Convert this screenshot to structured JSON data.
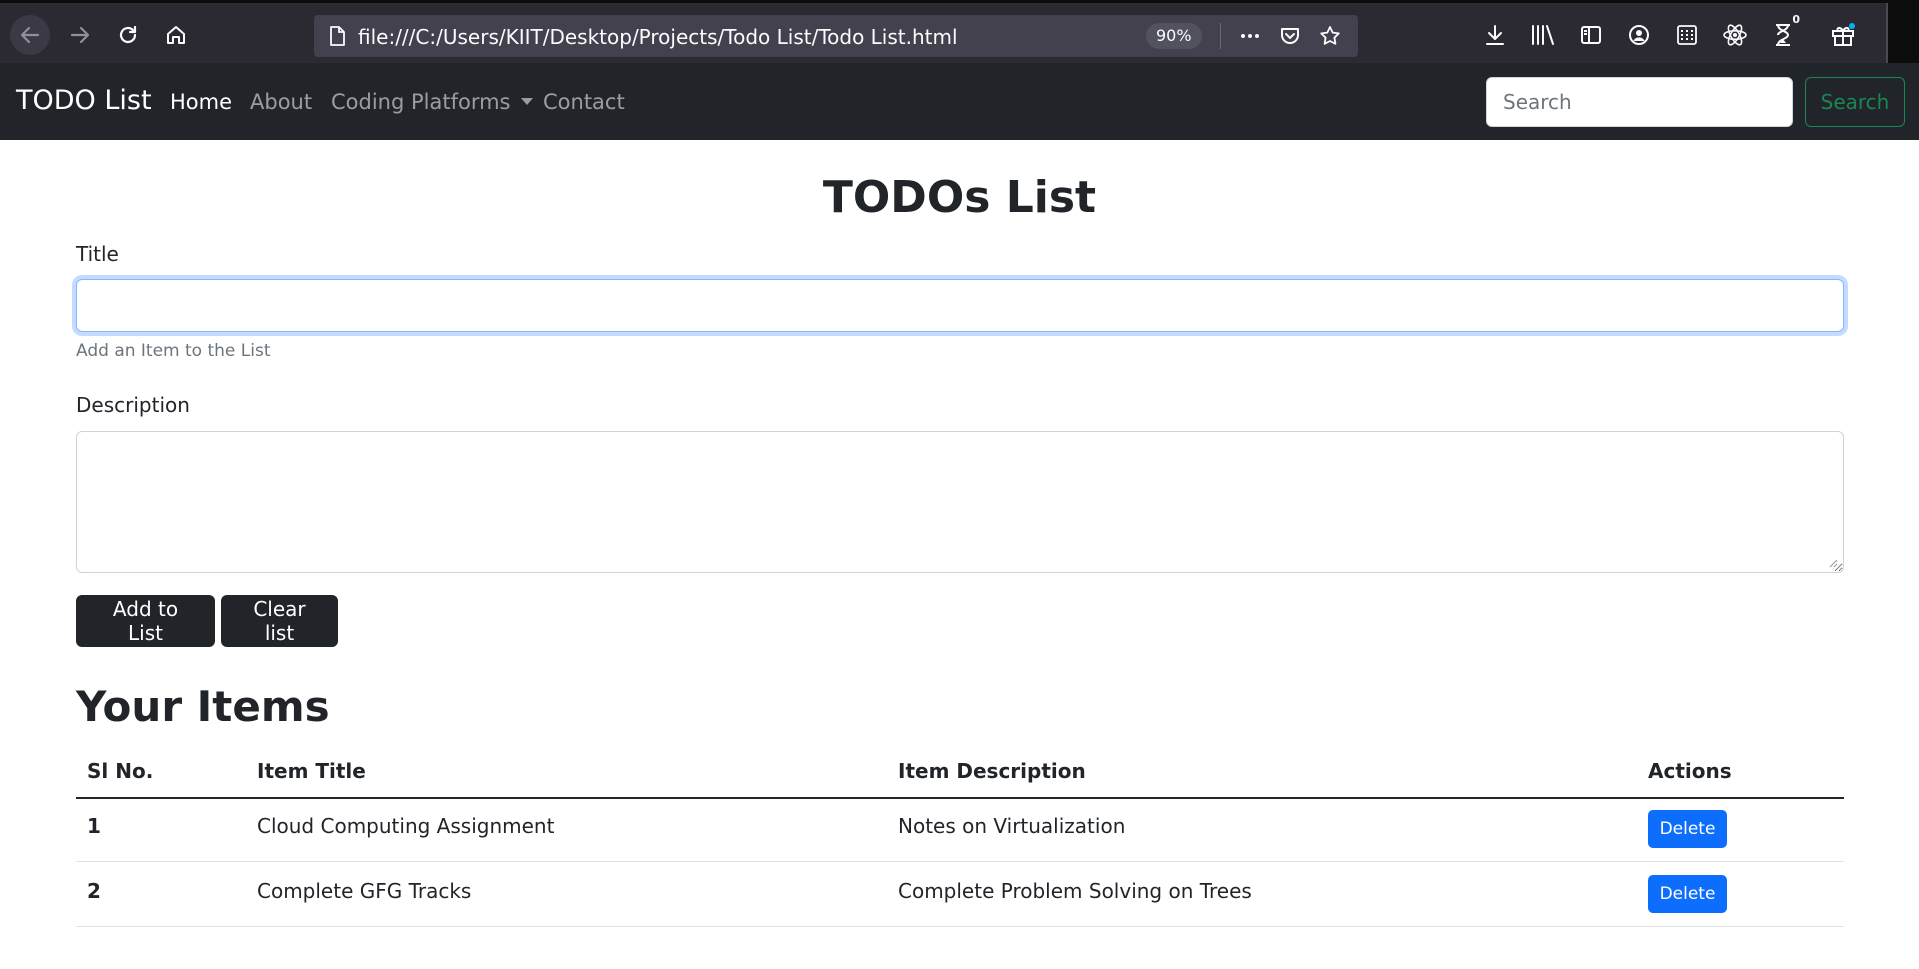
{
  "browser": {
    "url": "file:///C:/Users/KIIT/Desktop/Projects/Todo List/Todo List.html",
    "zoom": "90%",
    "notification_count": "0",
    "icons": [
      "back-icon",
      "forward-icon",
      "reload-icon",
      "home-icon",
      "page-icon",
      "more-icon",
      "pocket-icon",
      "bookmark-star-icon",
      "download-icon",
      "library-icon",
      "sidebar-icon",
      "account-icon",
      "apps-grid-icon",
      "react-icon",
      "timer-icon",
      "gift-icon"
    ]
  },
  "navbar": {
    "brand": "TODO List",
    "links": [
      {
        "label": "Home",
        "active": true
      },
      {
        "label": "About",
        "active": false
      },
      {
        "label": "Coding Platforms",
        "active": false
      },
      {
        "label": "Contact",
        "active": false
      }
    ],
    "search_placeholder": "Search",
    "search_button": "Search"
  },
  "main": {
    "title": "TODOs List",
    "title_label": "Title",
    "title_value": "",
    "title_help": "Add an Item to the List",
    "description_label": "Description",
    "description_value": "",
    "add_button": "Add to List",
    "clear_button": "Clear list"
  },
  "items": {
    "heading": "Your Items",
    "columns": [
      "Sl No.",
      "Item Title",
      "Item Description",
      "Actions"
    ],
    "rows": [
      {
        "num": "1",
        "title": "Cloud Computing Assignment",
        "description": "Notes on Virtualization",
        "action": "Delete"
      },
      {
        "num": "2",
        "title": "Complete GFG Tracks",
        "description": "Complete Problem Solving on Trees",
        "action": "Delete"
      }
    ]
  },
  "colors": {
    "navbar_bg": "#212529",
    "primary": "#0d6efd",
    "success": "#198754",
    "browser_bg": "#2b2a33"
  }
}
